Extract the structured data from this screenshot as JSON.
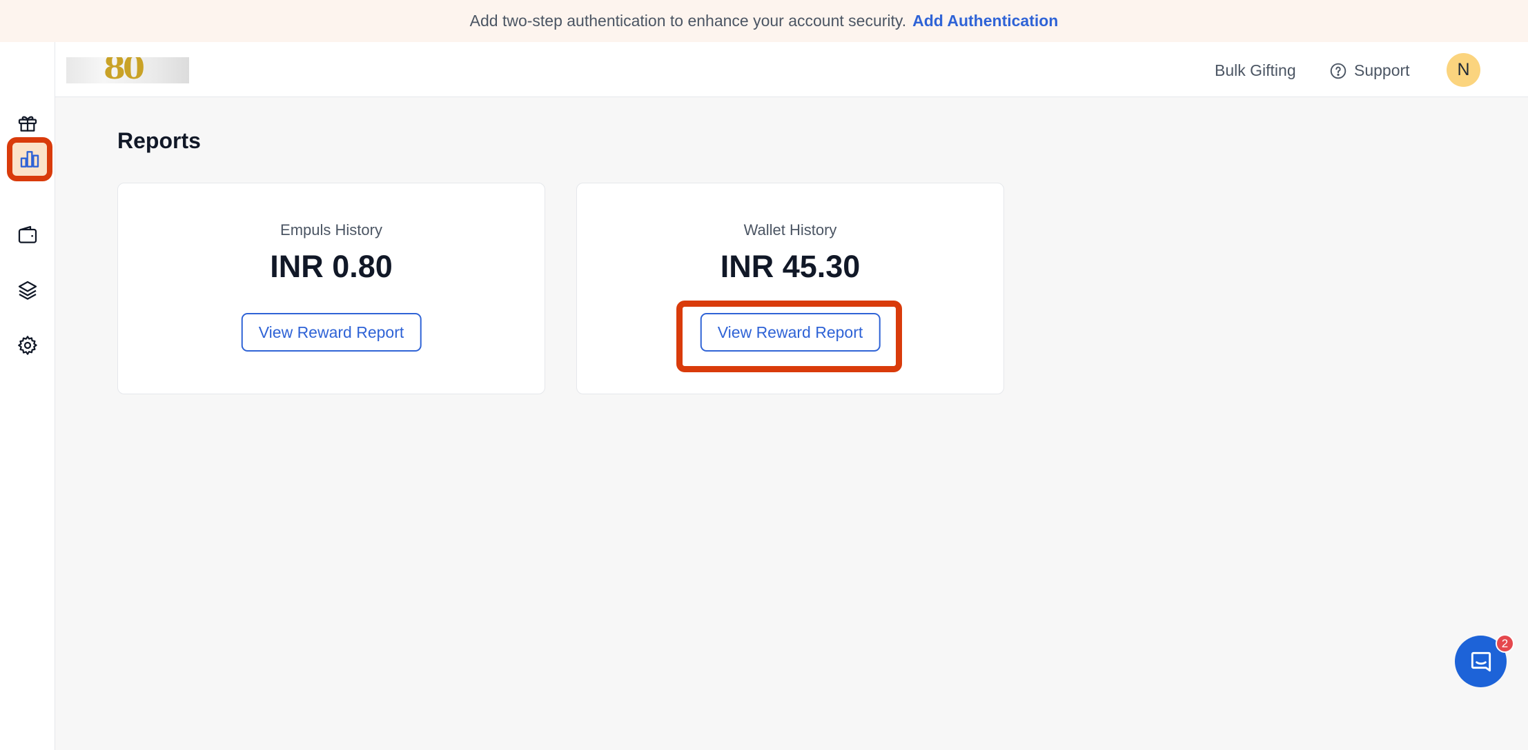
{
  "banner": {
    "message": "Add two-step authentication to enhance your account security.",
    "action": "Add Authentication"
  },
  "sidebar": {
    "items": [
      {
        "icon": "gift-icon"
      },
      {
        "icon": "bar-chart-icon",
        "active": true
      },
      {
        "icon": "wallet-icon"
      },
      {
        "icon": "layers-icon"
      },
      {
        "icon": "gear-icon"
      }
    ]
  },
  "header": {
    "bulk_gifting": "Bulk Gifting",
    "support": "Support",
    "avatar_initial": "N",
    "logo_text": "80"
  },
  "main": {
    "title": "Reports",
    "cards": [
      {
        "label": "Empuls History",
        "amount": "INR 0.80",
        "button": "View Reward Report"
      },
      {
        "label": "Wallet History",
        "amount": "INR 45.30",
        "button": "View Reward Report"
      }
    ]
  },
  "chat": {
    "badge_count": "2"
  },
  "colors": {
    "accent": "#2f63d6",
    "highlight": "#d93b0b",
    "banner_bg": "#fdf4ee"
  }
}
